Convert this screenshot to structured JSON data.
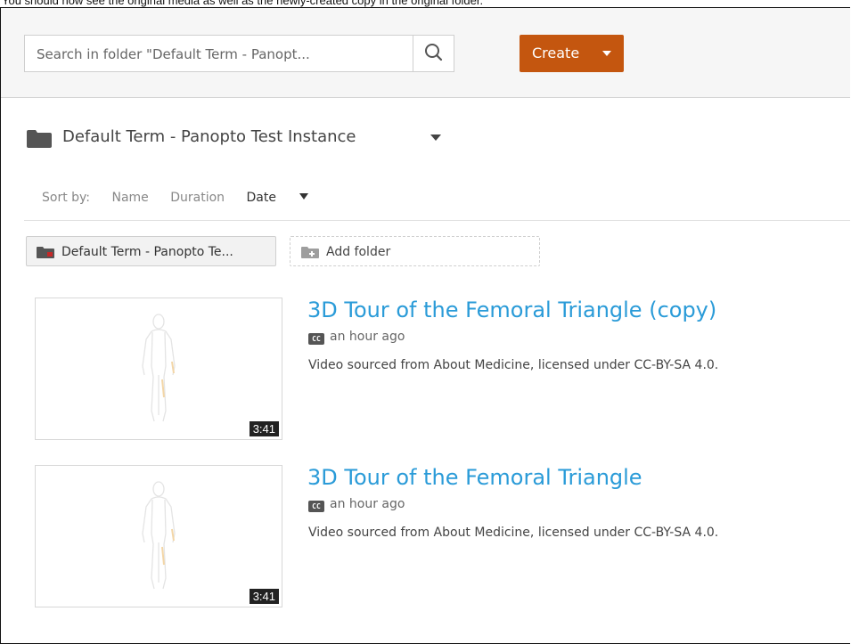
{
  "caption": "You should now see the original media as well as the newly-created copy in the original folder.",
  "search": {
    "placeholder": "Search in folder \"Default Term - Panopt...",
    "icon": "search-icon"
  },
  "create": {
    "label": "Create",
    "color": "#c4560f"
  },
  "folder": {
    "title": "Default Term - Panopto Test Instance"
  },
  "sort": {
    "label": "Sort by:",
    "options": [
      "Name",
      "Duration",
      "Date"
    ],
    "active": "Date"
  },
  "chips": {
    "current_folder": "Default Term - Panopto Te...",
    "add_folder": "Add folder"
  },
  "sessions": [
    {
      "title": "3D Tour of the Femoral Triangle (copy)",
      "time": "an hour ago",
      "description": "Video sourced from About Medicine, licensed under CC-BY-SA 4.0.",
      "duration": "3:41"
    },
    {
      "title": "3D Tour of the Femoral Triangle",
      "time": "an hour ago",
      "description": "Video sourced from About Medicine, licensed under CC-BY-SA 4.0.",
      "duration": "3:41"
    }
  ],
  "colors": {
    "link": "#2a9bd8",
    "accent": "#c4560f"
  }
}
